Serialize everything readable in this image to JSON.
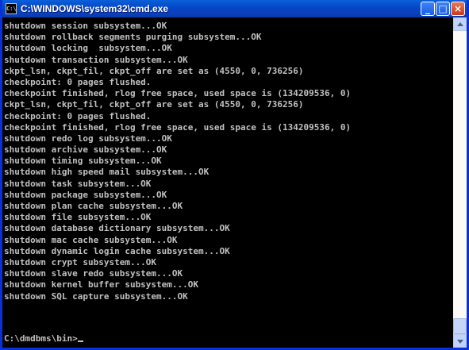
{
  "window": {
    "title": "C:\\WINDOWS\\system32\\cmd.exe",
    "app_icon_label": "C:\\",
    "controls": {
      "minimize": "_",
      "maximize": "□",
      "close": "×"
    }
  },
  "console": {
    "lines": [
      "shutdown session subsystem...OK",
      "shutdown rollback segments purging subsystem...OK",
      "shutdown locking  subsystem...OK",
      "shutdown transaction subsystem...OK",
      "ckpt_lsn, ckpt_fil, ckpt_off are set as (4550, 0, 736256)",
      "checkpoint: 0 pages flushed.",
      "checkpoint finished, rlog free space, used space is (134209536, 0)",
      "ckpt_lsn, ckpt_fil, ckpt_off are set as (4550, 0, 736256)",
      "checkpoint: 0 pages flushed.",
      "checkpoint finished, rlog free space, used space is (134209536, 0)",
      "shutdown redo log subsystem...OK",
      "shutdown archive subsystem...OK",
      "shutdown timing subsystem...OK",
      "shutdown high speed mail subsystem...OK",
      "shutdown task subsystem...OK",
      "shutdown package subsystem...OK",
      "shutdown plan cache subsystem...OK",
      "shutdown file subsystem...OK",
      "shutdown database dictionary subsystem...OK",
      "shutdown mac cache subsystem...OK",
      "shutdown dynamic login cache subsystem...OK",
      "shutdown crypt subsystem...OK",
      "shutdown slave redo subsystem...OK",
      "shutdown kernel buffer subsystem...OK",
      "shutdown SQL capture subsystem...OK"
    ],
    "prompt": "C:\\dmdbms\\bin>"
  },
  "scrollbar": {
    "position": 1.0
  },
  "colors": {
    "console_bg": "#000000",
    "console_text": "#c0c0c0",
    "titlebar": "#0446c7"
  }
}
